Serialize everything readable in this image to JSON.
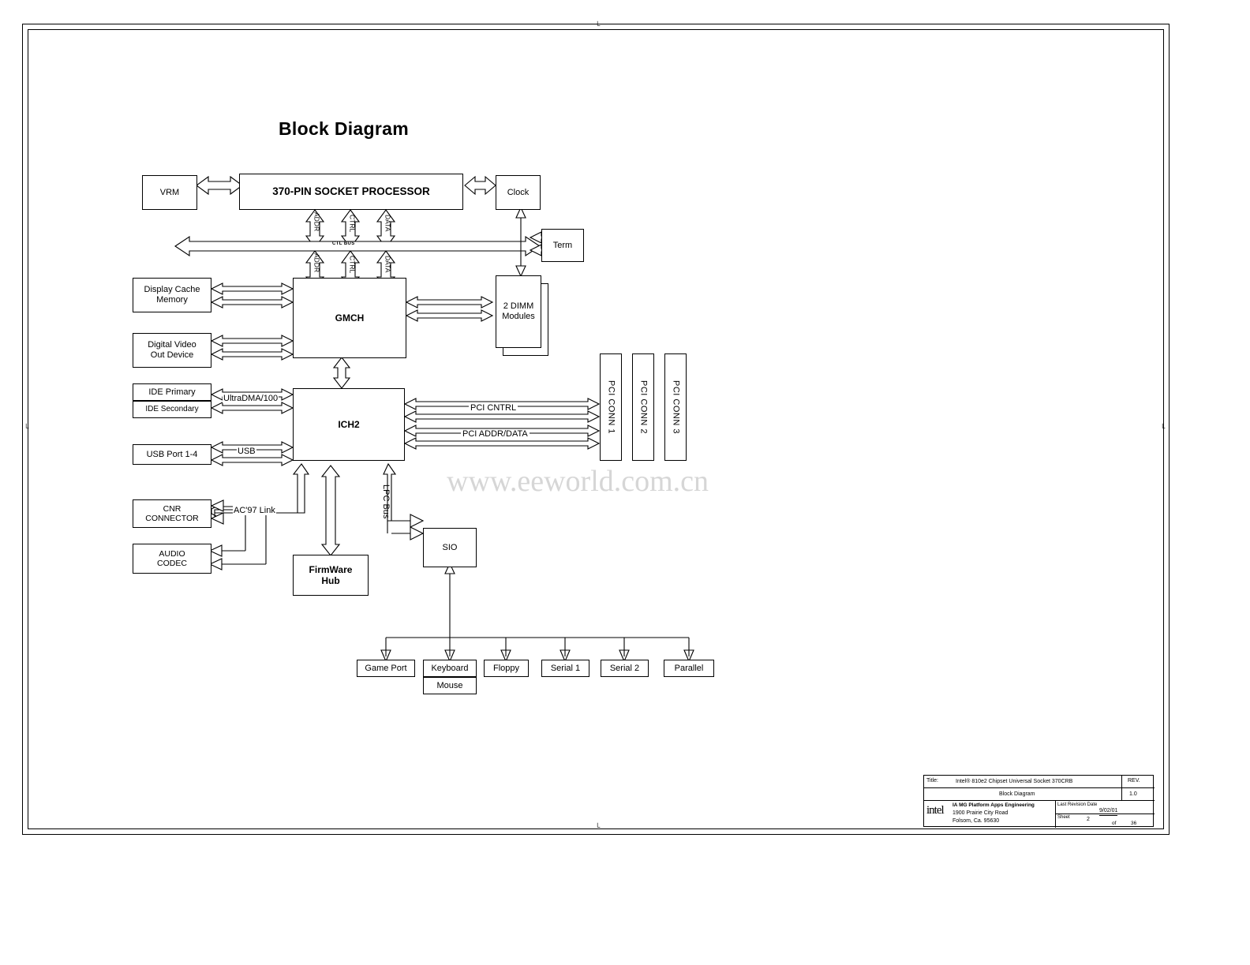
{
  "page": {
    "title": "Block Diagram",
    "watermark": "www.eeworld.com.cn"
  },
  "blocks": {
    "vrm": "VRM",
    "processor": "370-PIN SOCKET PROCESSOR",
    "clock": "Clock",
    "term": "Term",
    "display_cache": "Display Cache\nMemory",
    "digital_video": "Digital Video\nOut Device",
    "gmch": "GMCH",
    "dimm": "2 DIMM\nModules",
    "ide_primary": "IDE Primary",
    "ide_secondary": "IDE Secondary",
    "ich2": "ICH2",
    "usb_port": "USB Port 1-4",
    "cnr": "CNR\nCONNECTOR",
    "audio_codec": "AUDIO\nCODEC",
    "firmware_hub": "FirmWare\nHub",
    "sio": "SIO",
    "pci_conn_1": "PCI CONN 1",
    "pci_conn_2": "PCI CONN 2",
    "pci_conn_3": "PCI CONN 3",
    "game_port": "Game Port",
    "keyboard": "Keyboard",
    "mouse": "Mouse",
    "floppy": "Floppy",
    "serial1": "Serial 1",
    "serial2": "Serial 2",
    "parallel": "Parallel"
  },
  "bus_labels": {
    "addr_top": "ADDR",
    "ctrl_top": "CTRL",
    "data_top": "DATA",
    "addr_bottom": "ADDR",
    "ctrl_bottom": "CTRL",
    "data_bottom": "DATA",
    "ctl_bus": "CTL BUS",
    "ultradma": "UltraDMA/100",
    "usb": "USB",
    "ac97": "AC'97 Link",
    "lpc_bus": "LPC Bus",
    "pci_cntrl": "PCI CNTRL",
    "pci_addr_data": "PCI ADDR/DATA"
  },
  "title_block": {
    "title_label": "Title:",
    "title_line1": "Intel® 810e2 Chipset Universal Socket 370CRB",
    "title_line2": "Block Diagram",
    "rev_label": "REV.",
    "rev_value": "1.0",
    "company_line1": "IA MG Platform  Apps Engineering",
    "company_line2": "1900 Prairie City Road",
    "company_line3": "Folsom, Ca. 95630",
    "logo": "intel",
    "revision_label": "Last Revision Date",
    "revision_value": "9/02/01",
    "sheet_label": "Sheet",
    "sheet_number": "2",
    "sheet_of": "of",
    "sheet_total": "36"
  },
  "registration_mark": "└"
}
